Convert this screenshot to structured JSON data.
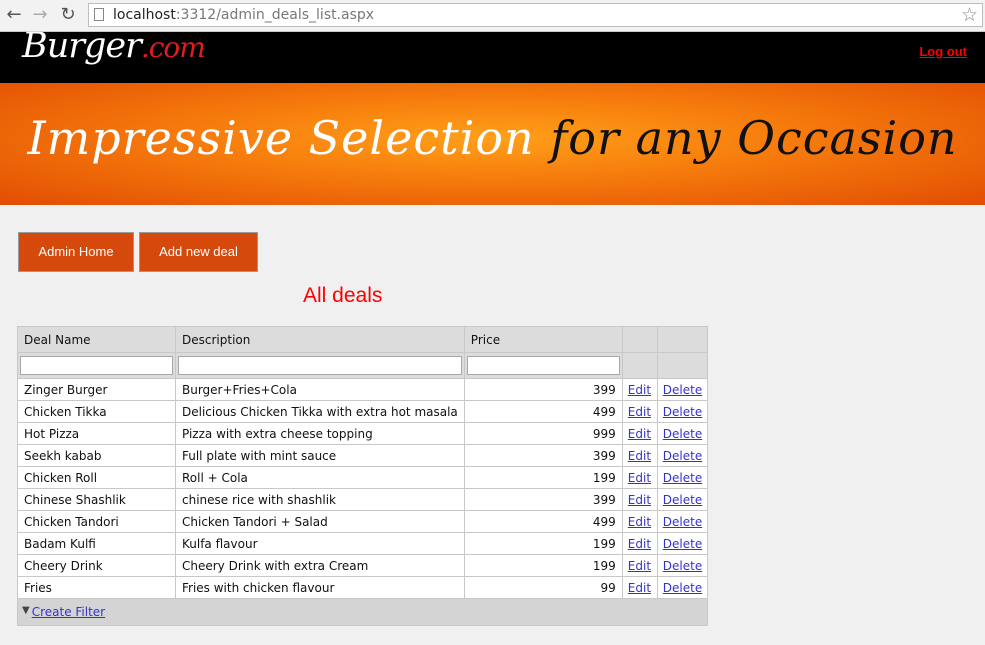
{
  "browser": {
    "url_host": "localhost",
    "url_rest": ":3312/admin_deals_list.aspx"
  },
  "header": {
    "logo_text": "Burger",
    "logo_suffix": ".com",
    "logout_label": "Log out"
  },
  "banner": {
    "slogan_white": "Impressive Selection ",
    "slogan_black": "for any Occasion"
  },
  "actions": {
    "admin_home_label": "Admin Home",
    "add_deal_label": "Add new deal"
  },
  "page_title": "All deals",
  "grid": {
    "columns": [
      "Deal Name",
      "Description",
      "Price",
      "",
      ""
    ],
    "edit_label": "Edit",
    "delete_label": "Delete",
    "rows": [
      {
        "name": "Zinger Burger",
        "description": "Burger+Fries+Cola",
        "price": "399"
      },
      {
        "name": "Chicken Tikka",
        "description": "Delicious Chicken Tikka with extra hot masala",
        "price": "499"
      },
      {
        "name": "Hot Pizza",
        "description": "Pizza with extra cheese topping",
        "price": "999"
      },
      {
        "name": "Seekh kabab",
        "description": "Full plate with mint sauce",
        "price": "399"
      },
      {
        "name": "Chicken Roll",
        "description": "Roll + Cola",
        "price": "199"
      },
      {
        "name": "Chinese Shashlik",
        "description": "chinese rice with shashlik",
        "price": "399"
      },
      {
        "name": "Chicken Tandori",
        "description": "Chicken Tandori + Salad",
        "price": "499"
      },
      {
        "name": "Badam Kulfi",
        "description": "Kulfa flavour",
        "price": "199"
      },
      {
        "name": "Cheery Drink",
        "description": "Cheery Drink with extra Cream",
        "price": "199"
      },
      {
        "name": "Fries",
        "description": "Fries with chicken flavour",
        "price": "99"
      }
    ],
    "create_filter_label": "Create Filter"
  }
}
